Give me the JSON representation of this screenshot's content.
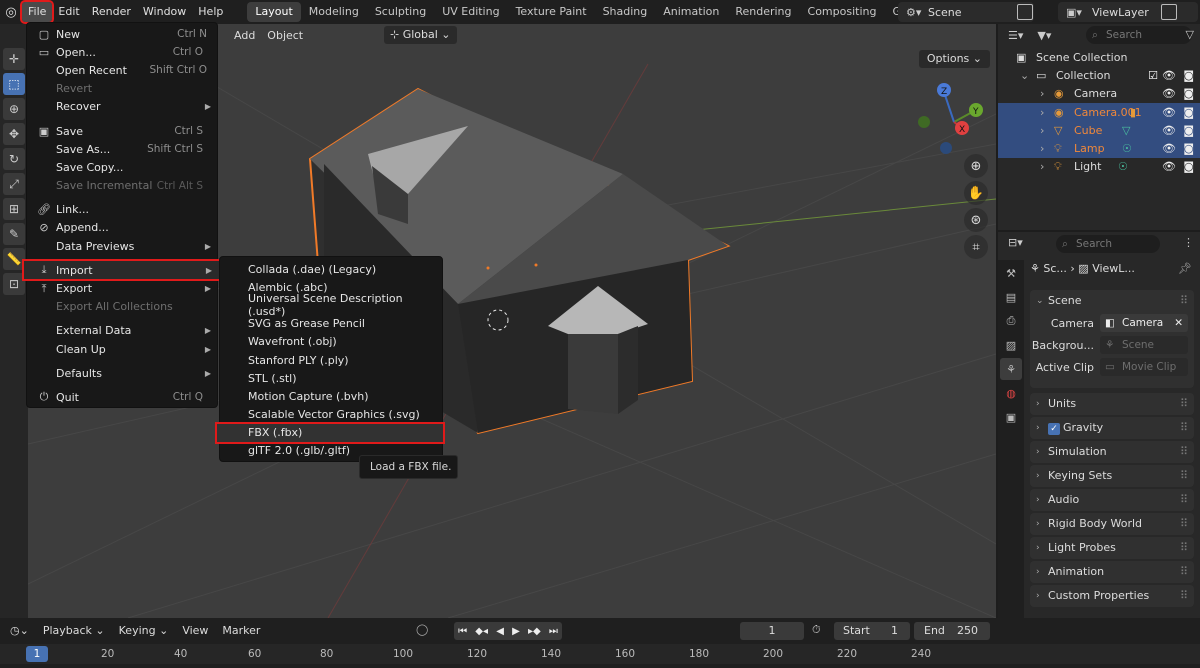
{
  "topbar": {
    "menus": [
      "File",
      "Edit",
      "Render",
      "Window",
      "Help"
    ],
    "workspaces": [
      "Layout",
      "Modeling",
      "Sculpting",
      "UV Editing",
      "Texture Paint",
      "Shading",
      "Animation",
      "Rendering",
      "Compositing",
      "Geometry N"
    ],
    "scene": "Scene",
    "view_layer": "ViewLayer"
  },
  "viewport_header": {
    "add": "Add",
    "object": "Object",
    "orientation": "Global",
    "options": "Options"
  },
  "file_menu": {
    "items": [
      {
        "label": "New",
        "shortcut": "Ctrl N"
      },
      {
        "label": "Open...",
        "shortcut": "Ctrl O"
      },
      {
        "label": "Open Recent",
        "shortcut": "Shift Ctrl O"
      },
      {
        "label": "Revert",
        "shortcut": ""
      },
      {
        "label": "Recover",
        "shortcut": ""
      },
      {
        "label": "Save",
        "shortcut": "Ctrl S"
      },
      {
        "label": "Save As...",
        "shortcut": "Shift Ctrl S"
      },
      {
        "label": "Save Copy...",
        "shortcut": ""
      },
      {
        "label": "Save Incremental",
        "shortcut": "Ctrl Alt S"
      },
      {
        "label": "Link...",
        "shortcut": ""
      },
      {
        "label": "Append...",
        "shortcut": ""
      },
      {
        "label": "Data Previews",
        "shortcut": ""
      },
      {
        "label": "Import",
        "shortcut": ""
      },
      {
        "label": "Export",
        "shortcut": ""
      },
      {
        "label": "Export All Collections",
        "shortcut": ""
      },
      {
        "label": "External Data",
        "shortcut": ""
      },
      {
        "label": "Clean Up",
        "shortcut": ""
      },
      {
        "label": "Defaults",
        "shortcut": ""
      },
      {
        "label": "Quit",
        "shortcut": "Ctrl Q"
      }
    ]
  },
  "import_menu": {
    "items": [
      "Collada (.dae) (Legacy)",
      "Alembic (.abc)",
      "Universal Scene Description (.usd*)",
      "SVG as Grease Pencil",
      "Wavefront (.obj)",
      "Stanford PLY (.ply)",
      "STL (.stl)",
      "Motion Capture (.bvh)",
      "Scalable Vector Graphics (.svg)",
      "FBX (.fbx)",
      "glTF 2.0 (.glb/.gltf)"
    ],
    "tooltip": "Load a FBX file."
  },
  "outliner": {
    "search_placeholder": "Search",
    "scene_collection": "Scene Collection",
    "collection": "Collection",
    "objects": [
      "Camera",
      "Camera.001",
      "Cube",
      "Lamp",
      "Light"
    ]
  },
  "properties": {
    "search_placeholder": "Search",
    "crumb_scene": "Sc...",
    "crumb_view": "ViewL...",
    "scene_panel": "Scene",
    "camera_label": "Camera",
    "camera_value": "Camera",
    "background_label": "Backgrou...",
    "background_value": "Scene",
    "clip_label": "Active Clip",
    "clip_value": "Movie Clip",
    "panels": [
      "Units",
      "Gravity",
      "Simulation",
      "Keying Sets",
      "Audio",
      "Rigid Body World",
      "Light Probes",
      "Animation",
      "Custom Properties"
    ]
  },
  "timeline": {
    "playback": "Playback",
    "keying": "Keying",
    "view": "View",
    "marker": "Marker",
    "current_frame": "1",
    "start_label": "Start",
    "start_value": "1",
    "end_label": "End",
    "end_value": "250",
    "ruler_current": "1",
    "ruler_ticks": [
      "20",
      "40",
      "60",
      "80",
      "100",
      "120",
      "140",
      "160",
      "180",
      "200",
      "220",
      "240"
    ]
  }
}
